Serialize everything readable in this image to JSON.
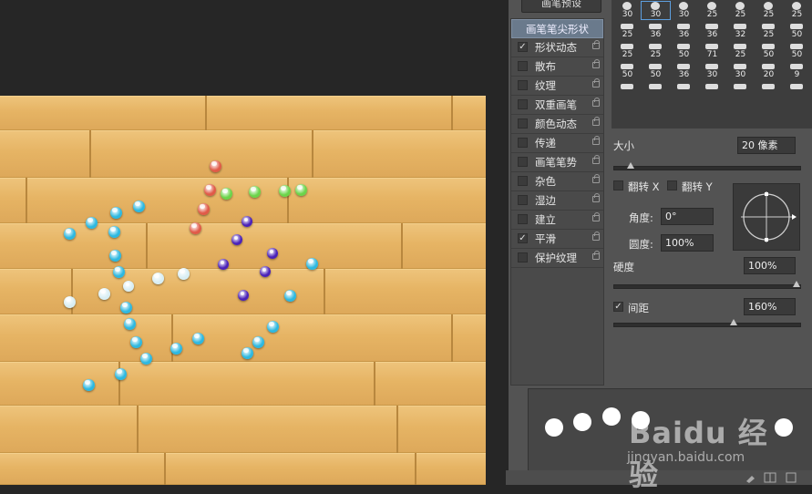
{
  "brush_panel": {
    "preset_button": "画笔预设",
    "list": [
      {
        "label": "画笔笔尖形状",
        "checked": false,
        "header": true
      },
      {
        "label": "形状动态",
        "checked": true
      },
      {
        "label": "散布",
        "checked": false
      },
      {
        "label": "纹理",
        "checked": false
      },
      {
        "label": "双重画笔",
        "checked": false
      },
      {
        "label": "颜色动态",
        "checked": false
      },
      {
        "label": "传递",
        "checked": false
      },
      {
        "label": "画笔笔势",
        "checked": false
      },
      {
        "label": "杂色",
        "checked": false
      },
      {
        "label": "湿边",
        "checked": false
      },
      {
        "label": "建立",
        "checked": false
      },
      {
        "label": "平滑",
        "checked": true
      },
      {
        "label": "保护纹理",
        "checked": false
      }
    ],
    "brush_sizes": [
      [
        "30",
        "30",
        "30",
        "25",
        "25",
        "25",
        "25"
      ],
      [
        "25",
        "36",
        "36",
        "36",
        "32",
        "25",
        "50"
      ],
      [
        "25",
        "25",
        "50",
        "71",
        "25",
        "50",
        "50"
      ],
      [
        "50",
        "50",
        "36",
        "30",
        "30",
        "20",
        "9"
      ],
      [
        "",
        "",
        "",
        "",
        "",
        "",
        ""
      ]
    ],
    "size_label": "大小",
    "size_value": "20 像素",
    "size_slider": 0.09,
    "flip_x_label": "翻转 X",
    "flip_y_label": "翻转 Y",
    "angle_label": "角度:",
    "angle_value": "0°",
    "roundness_label": "圆度:",
    "roundness_value": "100%",
    "hardness_label": "硬度",
    "hardness_value": "100%",
    "hardness_slider": 1.0,
    "spacing_label": "间距",
    "spacing_checked": true,
    "spacing_value": "160%",
    "spacing_slider": 0.64
  },
  "watermark": {
    "logo": "Baidu 经验",
    "url": "jingyan.baidu.com"
  },
  "colors": {
    "cyan": "#2db8e0",
    "red": "#e05a48",
    "green": "#6bd44a",
    "purple": "#4a22b8",
    "white": "#d8eef4"
  }
}
